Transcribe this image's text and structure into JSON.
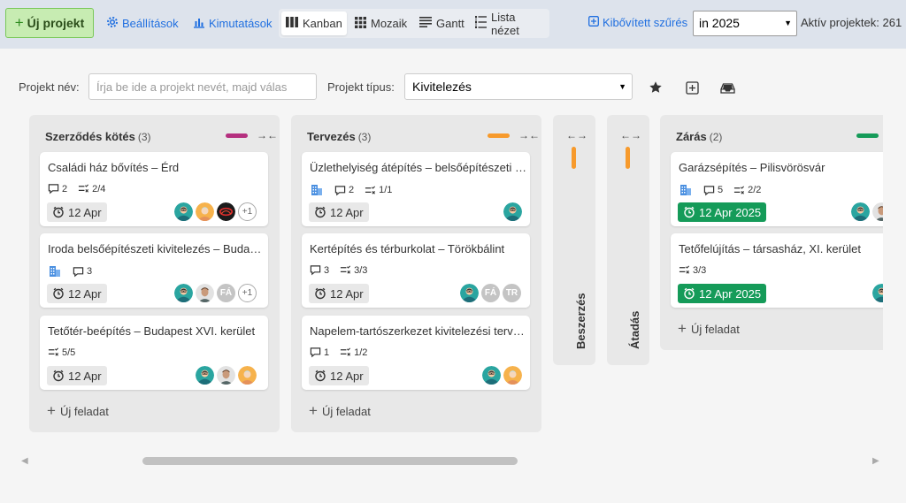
{
  "toolbar": {
    "new_project": "Új projekt",
    "settings": "Beállítások",
    "reports": "Kimutatások",
    "views": [
      "Kanban",
      "Mozaik",
      "Gantt",
      "Lista nézet"
    ],
    "advanced_filter": "Kibővített szűrés",
    "year_select": "in 2025",
    "active_count": "Aktív projektek: 261"
  },
  "filters": {
    "name_label": "Projekt név:",
    "name_placeholder": "Írja be ide a projekt nevét, majd válas",
    "type_label": "Projekt típus:",
    "type_value": "Kivitelezés"
  },
  "columns": {
    "c1": {
      "title": "Szerződés kötés",
      "count": "(3)",
      "color": "#b5307f",
      "add_task": "Új feladat",
      "cards": [
        {
          "title": "Családi ház bővítés – Érd",
          "comments": "2",
          "tasks": "2/4",
          "date": "12 Apr",
          "more": "+1"
        },
        {
          "title": "Iroda belsőépítészeti kivitelezés – Budaörs",
          "comments": "3",
          "date": "12 Apr",
          "initials": "FÁ",
          "more": "+1"
        },
        {
          "title": "Tetőtér-beépítés – Budapest XVI. kerület",
          "tasks": "5/5",
          "date": "12 Apr"
        }
      ]
    },
    "c2": {
      "title": "Tervezés",
      "count": "(3)",
      "color": "#f79a2c",
      "add_task": "Új feladat",
      "cards": [
        {
          "title": "Üzlethelyiség átépítés – belsőépítészeti á…",
          "comments": "2",
          "tasks": "1/1",
          "date": "12 Apr"
        },
        {
          "title": "Kertépítés és térburkolat – Törökbálint",
          "comments": "3",
          "tasks": "3/3",
          "date": "12 Apr",
          "initials1": "FÁ",
          "initials2": "TR"
        },
        {
          "title": "Napelem-tartószerkezet kivitelezési terv…",
          "comments": "1",
          "tasks": "1/2",
          "date": "12 Apr"
        }
      ]
    },
    "c3": {
      "title": "Beszerzés",
      "color": "#f79a2c"
    },
    "c4": {
      "title": "Átadás",
      "color": "#f79a2c"
    },
    "c5": {
      "title": "Zárás",
      "count": "(2)",
      "color": "#159b59",
      "add_task": "Új feladat",
      "cards": [
        {
          "title": "Garázsépítés – Pilisvörösvár",
          "comments": "5",
          "tasks": "2/2",
          "date": "12 Apr 2025"
        },
        {
          "title": "Tetőfelújítás – társasház, XI. kerület",
          "tasks": "3/3",
          "date": "12 Apr 2025"
        }
      ]
    }
  }
}
